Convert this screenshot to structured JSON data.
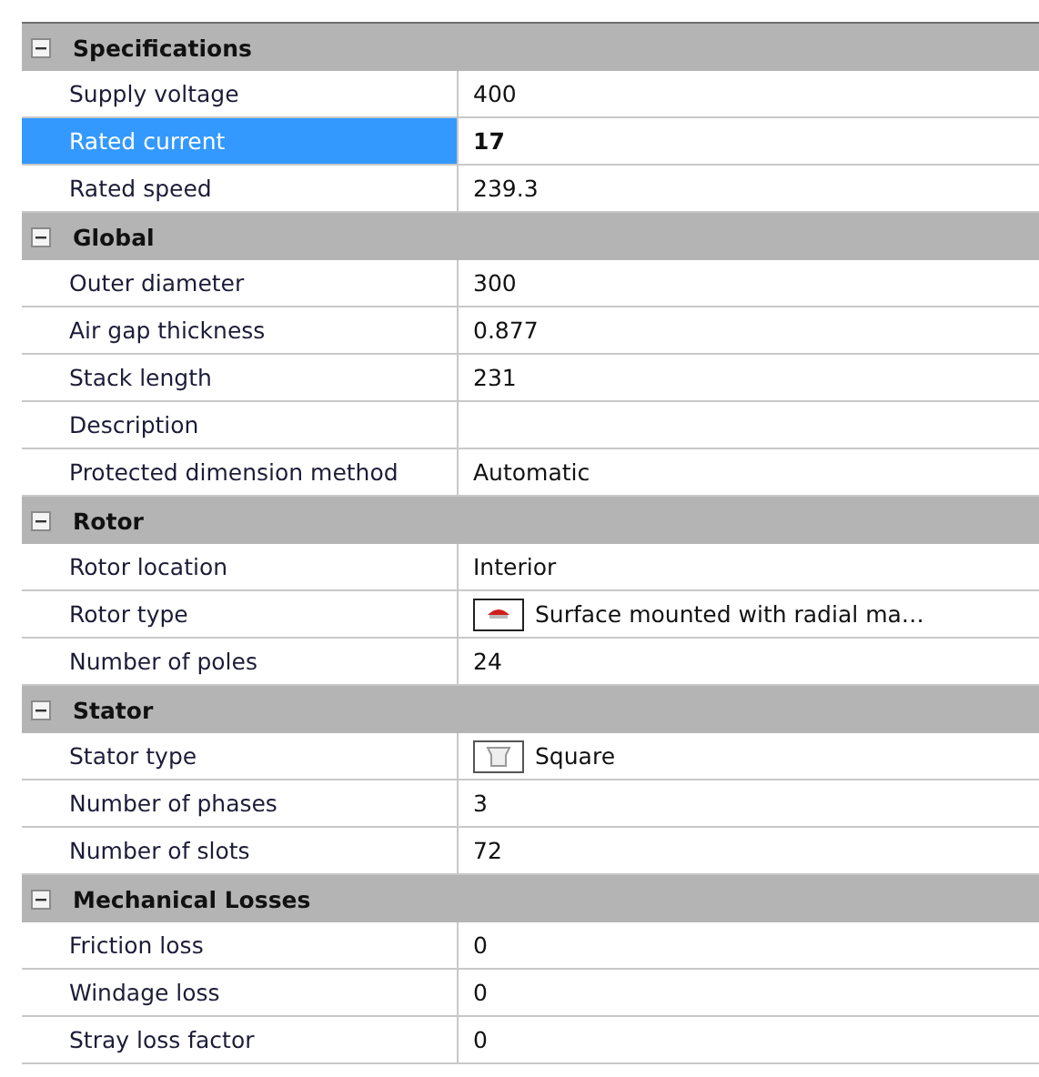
{
  "categories": [
    {
      "title": "Specifications",
      "expanded": true,
      "properties": [
        {
          "name": "Supply voltage",
          "value": "400",
          "kind": "text",
          "selected": false,
          "modified": false
        },
        {
          "name": "Rated current",
          "value": "17",
          "kind": "text",
          "selected": true,
          "modified": true
        },
        {
          "name": "Rated speed",
          "value": "239.3",
          "kind": "text",
          "selected": false,
          "modified": false
        }
      ]
    },
    {
      "title": "Global",
      "expanded": true,
      "properties": [
        {
          "name": "Outer diameter",
          "value": "300",
          "kind": "text",
          "selected": false,
          "modified": false
        },
        {
          "name": "Air gap thickness",
          "value": "0.877",
          "kind": "text",
          "selected": false,
          "modified": false
        },
        {
          "name": "Stack length",
          "value": "231",
          "kind": "text",
          "selected": false,
          "modified": false
        },
        {
          "name": "Description",
          "kind": "text",
          "selected": false
        },
        {
          "name": "Protected dimension method",
          "value": "Automatic",
          "kind": "text",
          "selected": false,
          "modified": false
        }
      ]
    },
    {
      "title": "Rotor",
      "expanded": true,
      "properties": [
        {
          "name": "Rotor location",
          "value": "Interior",
          "kind": "text",
          "selected": false,
          "modified": false
        },
        {
          "name": "Rotor type",
          "value": "Surface mounted with radial ma…",
          "kind": "rotor",
          "selected": false,
          "modified": false
        },
        {
          "name": "Number of poles",
          "value": "24",
          "kind": "text",
          "selected": false,
          "modified": false
        }
      ]
    },
    {
      "title": "Stator",
      "expanded": true,
      "properties": [
        {
          "name": "Stator type",
          "value": "Square",
          "kind": "stator",
          "selected": false,
          "modified": false
        },
        {
          "name": "Number of phases",
          "value": "3",
          "kind": "text",
          "selected": false,
          "modified": false
        },
        {
          "name": "Number of slots",
          "value": "72",
          "kind": "text",
          "selected": false,
          "modified": false
        }
      ]
    },
    {
      "title": "Mechanical Losses",
      "expanded": true,
      "properties": [
        {
          "name": "Friction loss",
          "value": "0",
          "kind": "text",
          "selected": false,
          "modified": false
        },
        {
          "name": "Windage loss",
          "value": "0",
          "kind": "text",
          "selected": false,
          "modified": false
        },
        {
          "name": "Stray loss factor",
          "value": "0",
          "kind": "text",
          "selected": false,
          "modified": false
        }
      ]
    }
  ]
}
